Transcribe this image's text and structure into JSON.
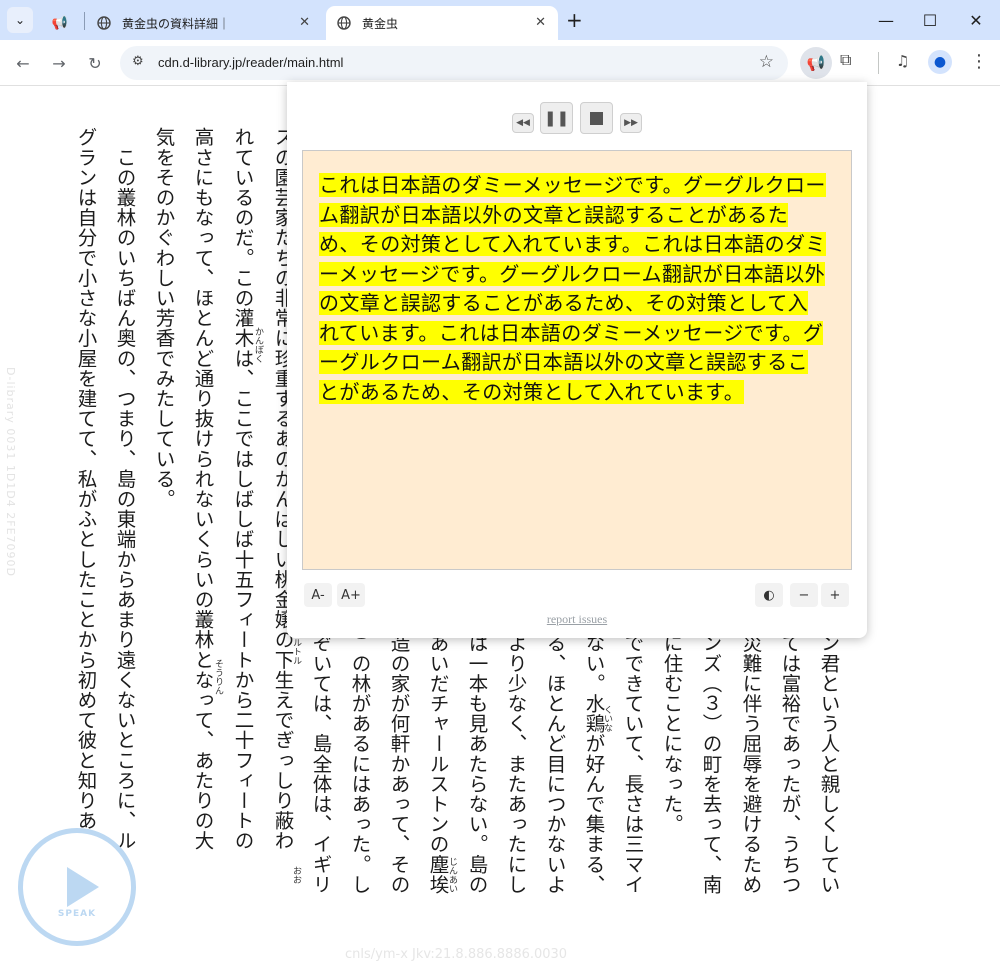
{
  "tabs": [
    {
      "title": "",
      "icon": "megaphone-icon"
    },
    {
      "title": "黄金虫の資料詳細｜",
      "icon": "globe-icon"
    },
    {
      "title": "黄金虫",
      "icon": "globe-icon"
    }
  ],
  "address_bar": {
    "url": "cdn.d-library.jp/reader/main.html"
  },
  "reader": {
    "columns_full": [
      "スの園芸家たちの非常に珍重するあのかんばしい桃金嬢の下生えでぎっしり蔽わ",
      "れているのだ。この灌木は、ここではしばしば十五フィートから二十フィートの",
      "高さにもなって、ほとんど通り抜けられないくらいの叢林となって、あたりの大",
      "気をそのかぐわしい芳香でみたしている。",
      "　この叢林のいちばん奥の、つまり、島の東端からあまり遠くないところに、ル",
      "グランは自分で小さな小屋を建てて、私がふとしたことから初めて彼と知りあ"
    ],
    "columns_lower": [
      "ン君という人と親しくしてい",
      "ては富裕であったが、うちつ",
      "災難に伴う屈辱を避けるため",
      "ンズ（３）の町を去って、南",
      "に住むことになった。",
      "でできていて、長さは三マイ",
      "ない。水鶏が好んで集まる、",
      "る、ほとんど目につかないよ",
      "より少なく、またあったにし",
      "は一本も見あたらない。島の",
      "あいだチャールストンの塵埃",
      "造の家が何軒かあって、その",
      "）の林があるにはあった。し",
      "ぞいては、島全体は、イギリ"
    ],
    "ruby": [
      "かんぼく",
      "そうりん",
      "くいな",
      "じんあい",
      "おお",
      "ミルトル"
    ]
  },
  "watermark_left": "D-library 0031 1D1D4 2FE7090D",
  "watermark_bottom": "cnls/ym-x Jkv:21.8.886.8886.0030",
  "speak_button": {
    "label": "SPEAK"
  },
  "popup": {
    "text": "これは日本語のダミーメッセージです。グーグルクローム翻訳が日本語以外の文章と誤認することがあるため、その対策として入れています。これは日本語のダミーメッセージです。グーグルクローム翻訳が日本語以外の文章と誤認することがあるため、その対策として入れています。これは日本語のダミーメッセージです。グーグルクローム翻訳が日本語以外の文章と誤認することがあるため、その対策として入れています。",
    "font_decrease": "A-",
    "font_increase": "A+",
    "speed_decrease": "−",
    "speed_increase": "+",
    "report_link": "report issues"
  },
  "colors": {
    "highlight": "#ffff00",
    "text_bg": "#ffecd2",
    "tabstrip": "#d3e3fd",
    "speak_ring": "#bcd8f2"
  }
}
